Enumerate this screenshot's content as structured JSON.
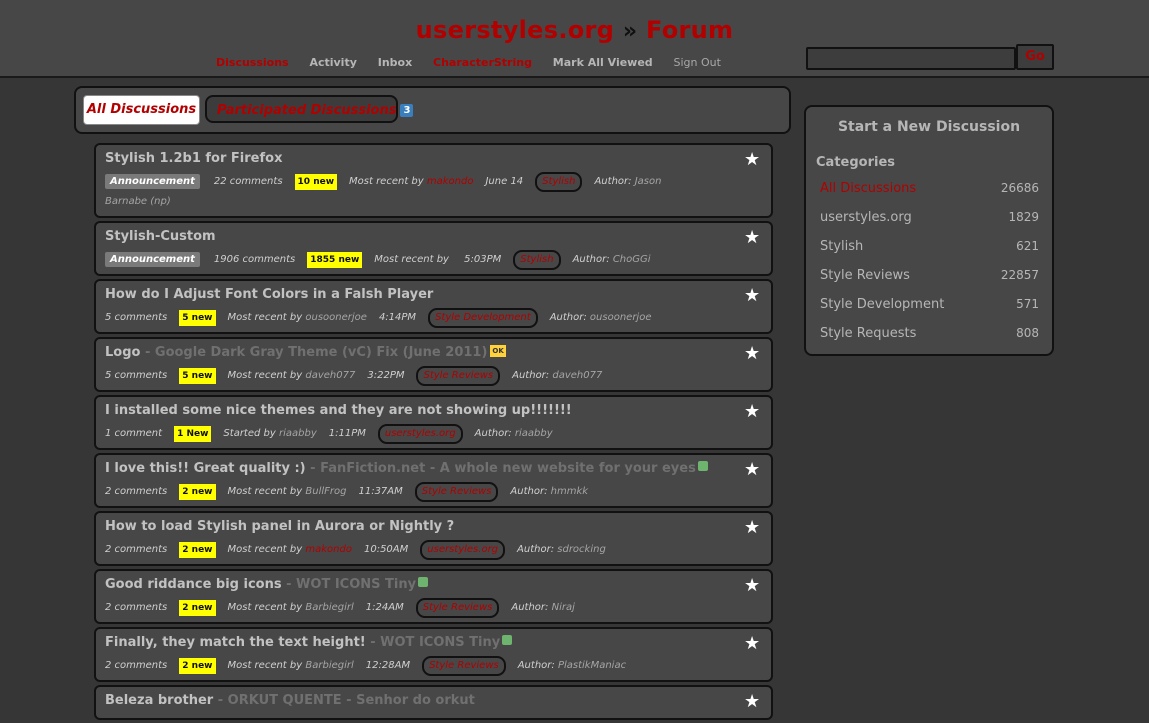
{
  "site": {
    "name": "userstyles.org",
    "separator": "»",
    "section": "Forum"
  },
  "nav": [
    "Discussions",
    "Activity",
    "Inbox",
    "CharacterString",
    "Mark All Viewed",
    "Sign Out"
  ],
  "search": {
    "button": "Go",
    "value": ""
  },
  "tabs": {
    "all": "All Discussions",
    "participated": "Participated Discussions",
    "participated_count": "3"
  },
  "discussions": [
    {
      "title": "Stylish 1.2b1 for Firefox",
      "extra": "",
      "announcement": "Announcement",
      "comments": "22 comments",
      "new": "10 new",
      "recent_label": "Most recent by",
      "recent_user": "makondo",
      "time": "June 14",
      "category": "Stylish",
      "author_label": "Author:",
      "author": "Jason",
      "author_wrap": "Barnabe (np)"
    },
    {
      "title": "Stylish-Custom",
      "extra": "",
      "announcement": "Announcement",
      "comments": "1906 comments",
      "new": "1855 new",
      "recent_label": "Most recent by",
      "recent_user": "",
      "time": "5:03PM",
      "category": "Stylish",
      "author_label": "Author:",
      "author": "ChoGGi"
    },
    {
      "title": "How do I Adjust Font Colors in a Falsh Player",
      "extra": "",
      "comments": "5 comments",
      "new": "5 new",
      "recent_label": "Most recent by",
      "recent_user": "ousoonerjoe",
      "time": "4:14PM",
      "category": "Style Development",
      "author_label": "Author:",
      "author": "ousoonerjoe"
    },
    {
      "title": "Logo",
      "extra": " - Google Dark Gray Theme (vC) Fix (June 2011)",
      "ok": "OK",
      "comments": "5 comments",
      "new": "5 new",
      "recent_label": "Most recent by",
      "recent_user": "daveh077",
      "time": "3:22PM",
      "category": "Style Reviews",
      "author_label": "Author:",
      "author": "daveh077"
    },
    {
      "title": "I installed some nice themes and they are not showing up!!!!!!!",
      "extra": "",
      "comments": "1 comment",
      "new": "1 New",
      "recent_label": "Started by",
      "recent_user": "riaabby",
      "time": "1:11PM",
      "category": "userstyles.org",
      "author_label": "Author:",
      "author": "riaabby"
    },
    {
      "title": "I love this!! Great quality :)",
      "extra": " - FanFiction.net - A whole new website for your eyes",
      "thumb": true,
      "comments": "2 comments",
      "new": "2 new",
      "recent_label": "Most recent by",
      "recent_user": "BullFrog",
      "time": "11:37AM",
      "category": "Style Reviews",
      "author_label": "Author:",
      "author": "hmmkk"
    },
    {
      "title": "How to load Stylish panel in Aurora or Nightly ?",
      "extra": "",
      "comments": "2 comments",
      "new": "2 new",
      "recent_label": "Most recent by",
      "recent_user": "makondo",
      "time": "10:50AM",
      "category": "userstyles.org",
      "author_label": "Author:",
      "author": "sdrocking"
    },
    {
      "title": "Good riddance big icons",
      "extra": " - WOT ICONS Tiny",
      "thumb": true,
      "comments": "2 comments",
      "new": "2 new",
      "recent_label": "Most recent by",
      "recent_user": "Barbiegirl",
      "time": "1:24AM",
      "category": "Style Reviews",
      "author_label": "Author:",
      "author": "Niraj"
    },
    {
      "title": "Finally, they match the text height!",
      "extra": " - WOT ICONS Tiny",
      "thumb": true,
      "comments": "2 comments",
      "new": "2 new",
      "recent_label": "Most recent by",
      "recent_user": "Barbiegirl",
      "time": "12:28AM",
      "category": "Style Reviews",
      "author_label": "Author:",
      "author": "PlastikManiac"
    },
    {
      "title": "Beleza brother",
      "extra": " - ORKUT QUENTE - Senhor do orkut",
      "comments": "",
      "new": "",
      "recent_label": "",
      "recent_user": "",
      "time": "",
      "category": "",
      "author_label": "",
      "author": ""
    }
  ],
  "sidebar": {
    "start": "Start a New Discussion",
    "categories_heading": "Categories",
    "categories": [
      {
        "name": "All Discussions",
        "count": "26686",
        "active": true
      },
      {
        "name": "userstyles.org",
        "count": "1829"
      },
      {
        "name": "Stylish",
        "count": "621"
      },
      {
        "name": "Style Reviews",
        "count": "22857"
      },
      {
        "name": "Style Development",
        "count": "571"
      },
      {
        "name": "Style Requests",
        "count": "808"
      }
    ]
  },
  "colors": {
    "accent": "#b20000",
    "new_badge": "#ffff00",
    "background": "#363636",
    "panel": "#474747"
  }
}
